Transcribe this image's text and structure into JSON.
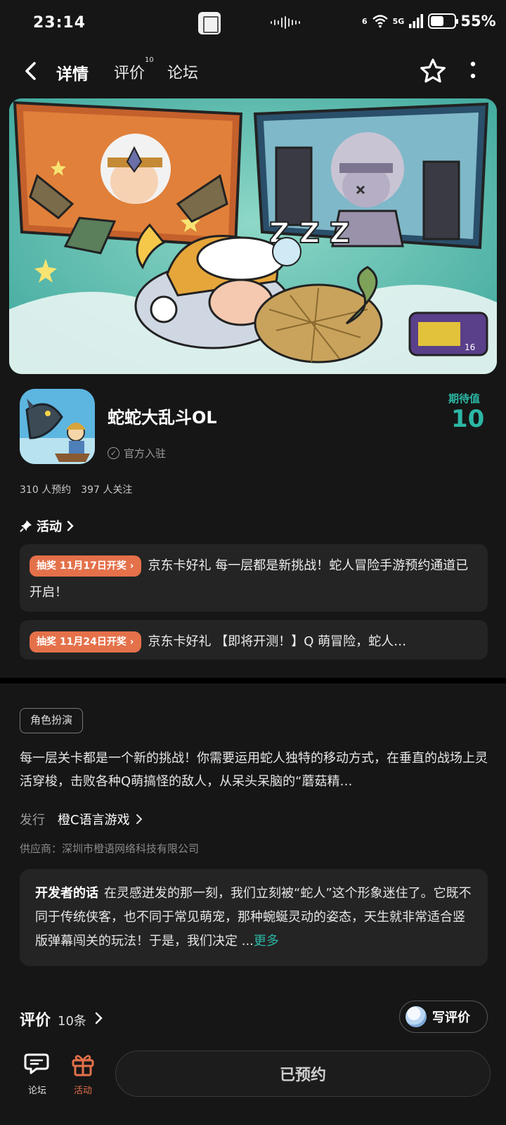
{
  "status_bar": {
    "time": "23:14",
    "network": "5G",
    "wifi_badge": "6",
    "battery": "55%"
  },
  "nav": {
    "tabs": [
      {
        "label": "详情",
        "active": true
      },
      {
        "label": "评价",
        "badge": "10"
      },
      {
        "label": "论坛"
      }
    ]
  },
  "game": {
    "title": "蛇蛇大乱斗OL",
    "official_badge": "官方入驻",
    "expect_label": "期待值",
    "expect_value": "10",
    "stats": "310 人预约　397 人关注"
  },
  "activities": {
    "header": "活动",
    "items": [
      {
        "tag": "抽奖 11月17日开奖",
        "text": "京东卡好礼 每一层都是新挑战！蛇人冒险手游预约通道已开启！"
      },
      {
        "tag": "抽奖 11月24日开奖",
        "text": "京东卡好礼 【即将开测！】Q 萌冒险，蛇人…"
      }
    ]
  },
  "details": {
    "genre": "角色扮演",
    "description": "每一层关卡都是一个新的挑战！你需要运用蛇人独特的移动方式，在垂直的战场上灵活穿梭，击败各种Q萌搞怪的敌人，从呆头呆脑的“蘑菇精…",
    "publisher_label": "发行",
    "publisher_name": "橙C语言游戏",
    "supplier": "供应商：深圳市橙语网络科技有限公司",
    "dev_note_label": "开发者的话",
    "dev_note": "在灵感迸发的那一刻，我们立刻被“蛇人”这个形象迷住了。它既不同于传统侠客，也不同于常见萌宠，那种蜿蜒灵动的姿态，天生就非常适合竖版弹幕闯关的玩法！于是，我们决定 ...",
    "more": "更多"
  },
  "reviews": {
    "title": "评价",
    "count": "10条",
    "write_label": "写评价"
  },
  "bottom_bar": {
    "forum_label": "论坛",
    "activity_label": "活动",
    "reserve_label": "已预约"
  },
  "banner": {
    "logo_badge": "16"
  },
  "colors": {
    "accent": "#2bb7a4",
    "tag_orange": "#e4714a",
    "background": "#161616",
    "card": "#242424"
  }
}
